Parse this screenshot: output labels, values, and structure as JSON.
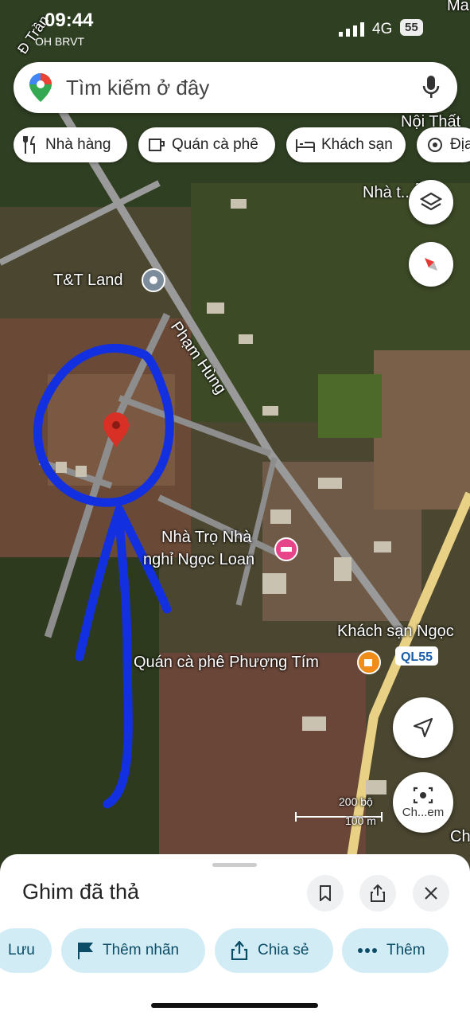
{
  "status_bar": {
    "time": "09:44",
    "carrier_sub": "OH BRVT",
    "network": "4G",
    "battery": "55"
  },
  "search": {
    "placeholder": "Tìm kiếm ở đây"
  },
  "chips": [
    "Nhà hàng",
    "Quán cà phê",
    "Khách sạn",
    "Địa"
  ],
  "map_labels": {
    "tt_land": "T&T Land",
    "pham_hung": "Phạm Hùng",
    "nha_tro_1": "Nhà Trọ Nhà",
    "nha_tro_2": "nghỉ Ngọc Loan",
    "khach_san": "Khách sạn Ngọc",
    "quan_ca_phe": "Quán cà phê Phượng Tím",
    "ql55": "QL55",
    "noi_that": "Nội Thất",
    "nha_t": "Nhà t...ẫn",
    "d_tran": "Đ Trần",
    "ma": "Ma",
    "ch": "Ch",
    "scale_ft": "200 bộ",
    "scale_m": "100 m",
    "lens_label": "Ch...em"
  },
  "sheet": {
    "title": "Ghim đã thả",
    "actions": [
      "Lưu",
      "Thêm nhãn",
      "Chia sẻ",
      "Thêm"
    ]
  },
  "colors": {
    "accent_blue": "#1a73e8",
    "pin_red": "#d93025",
    "annotation_blue": "#1330e0",
    "action_bg": "#d2ecf5"
  }
}
